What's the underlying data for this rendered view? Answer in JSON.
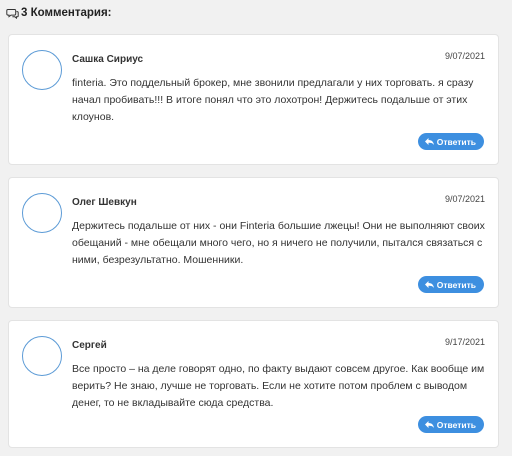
{
  "header": {
    "count_label": "3 Комментария:"
  },
  "comments": [
    {
      "author": "Сашка Сириус",
      "date": "9/07/2021",
      "text": "finteria. Это поддельный брокер, мне звонили предлагали у них торговать. я сразу начал пробивать!!! В итоге понял что это лохотрон! Держитесь подальше от этих клоунов.",
      "reply_label": "Ответить"
    },
    {
      "author": "Олег Шевкун",
      "date": "9/07/2021",
      "text": "Держитесь подальше от них - они Finteria большие лжецы! Они не выполняют своих обещаний - мне обещали много чего, но я ничего не получили, пытался связаться с ними, безрезультатно. Мошенники.",
      "reply_label": "Ответить"
    },
    {
      "author": "Сергей",
      "date": "9/17/2021",
      "text": "Все просто – на деле говорят одно, по факту выдают совсем другое. Как вообще им верить? Не знаю, лучше не торговать. Если не хотите потом проблем с выводом денег, то не вкладывайте сюда средства.",
      "reply_label": "Ответить"
    }
  ],
  "colors": {
    "accent": "#3d8fe0",
    "avatar_border": "#5c9bd6",
    "background": "#f1f1f1"
  },
  "icons": {
    "header": "comments-icon",
    "reply": "reply-arrow-icon"
  }
}
